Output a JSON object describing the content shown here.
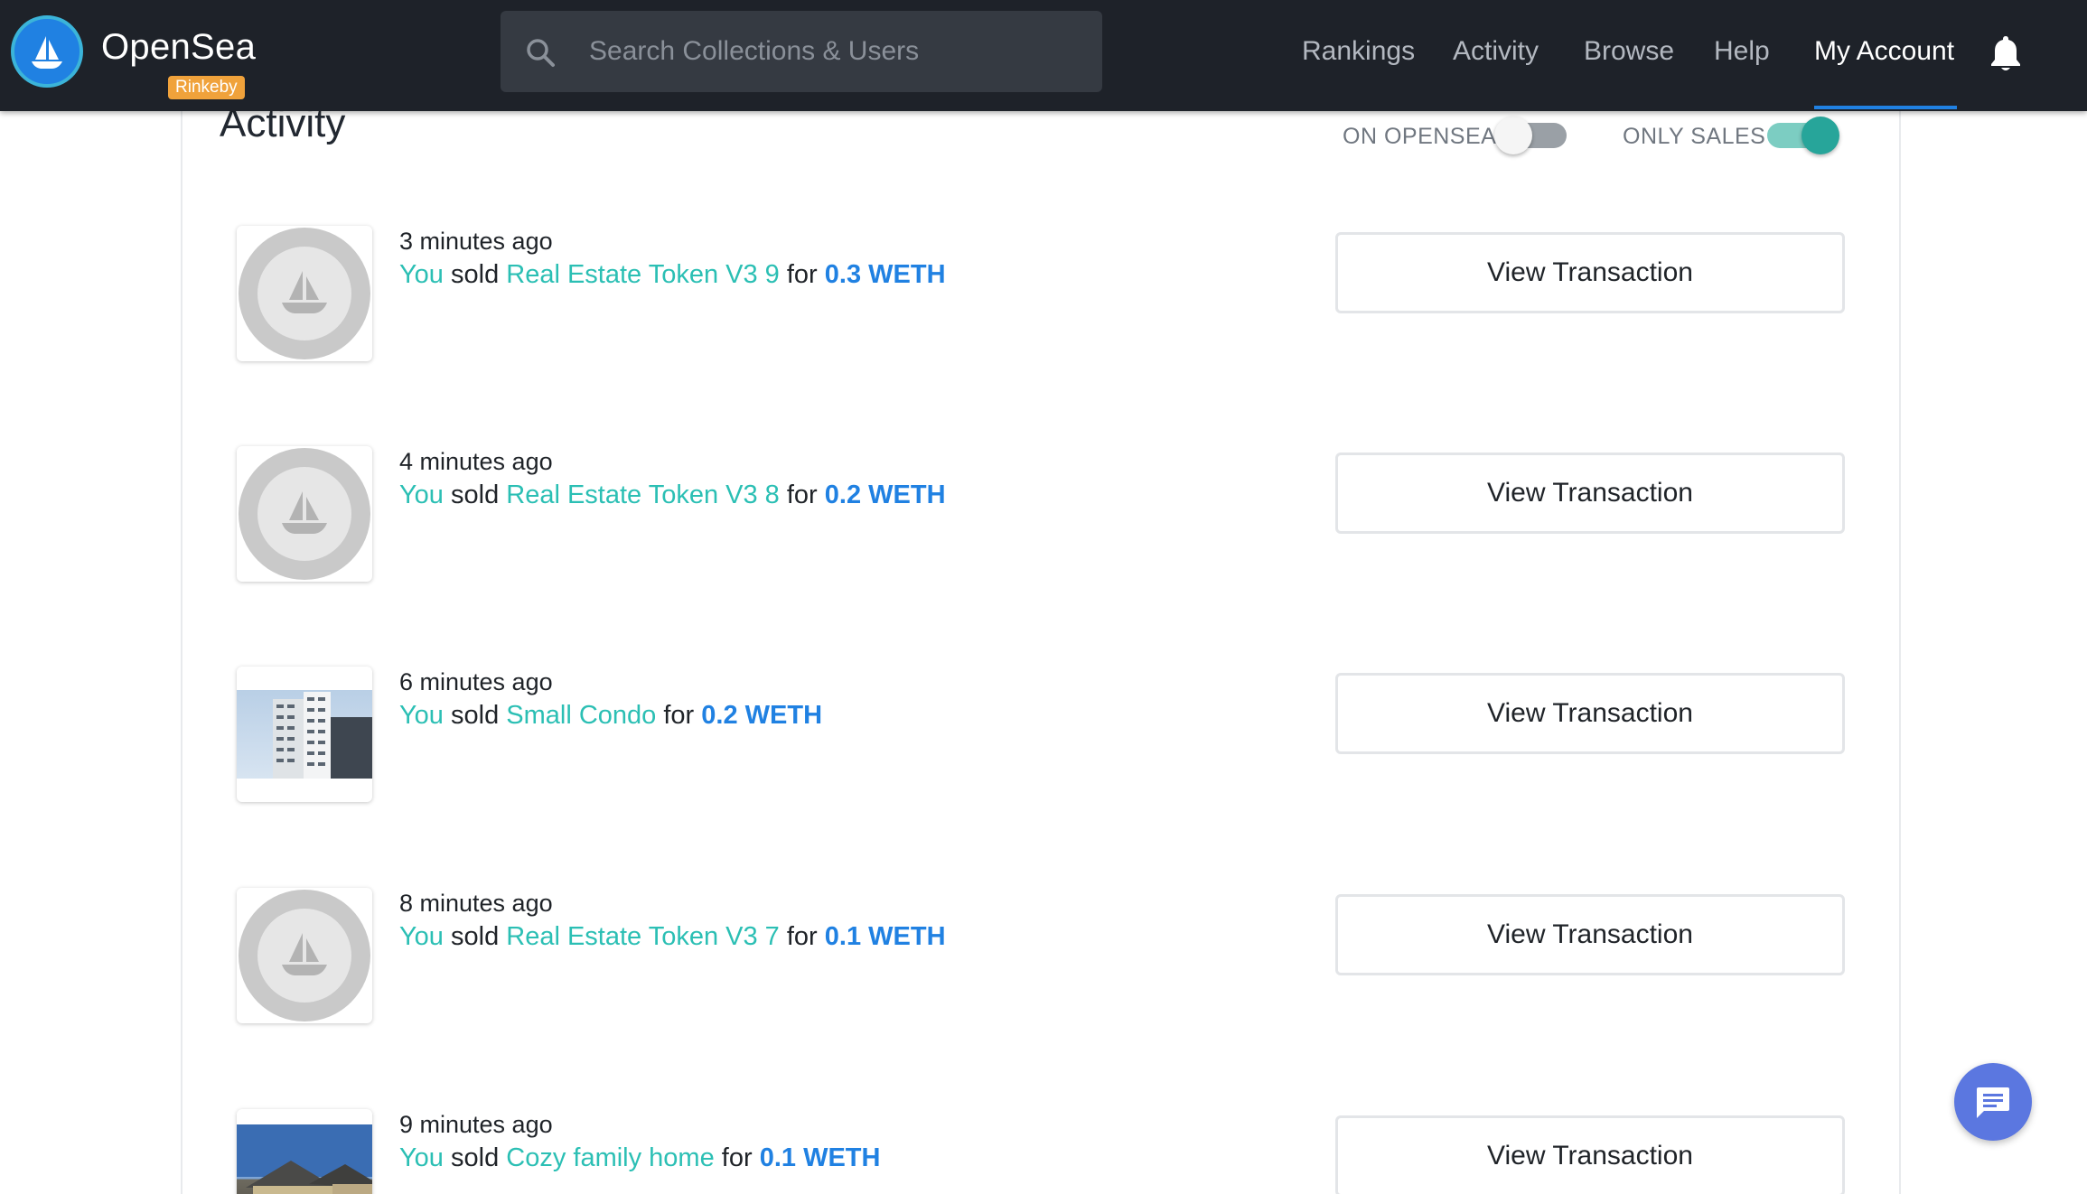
{
  "header": {
    "brand": "OpenSea",
    "network_badge": "Rinkeby",
    "search_placeholder": "Search Collections & Users",
    "nav": [
      {
        "label": "Rankings"
      },
      {
        "label": "Activity"
      },
      {
        "label": "Browse"
      },
      {
        "label": "Help"
      },
      {
        "label": "My Account",
        "active": true
      }
    ]
  },
  "page": {
    "title": "Activity",
    "filters": [
      {
        "label": "ON OPENSEA",
        "on": false
      },
      {
        "label": "ONLY SALES",
        "on": true
      }
    ]
  },
  "activity": [
    {
      "time": "3 minutes ago",
      "actor": "You",
      "verb": "sold",
      "item": "Real Estate Token V3 9",
      "for": "for",
      "price": "0.3 WETH",
      "button": "View Transaction",
      "thumb": "ship-placeholder-icon"
    },
    {
      "time": "4 minutes ago",
      "actor": "You",
      "verb": "sold",
      "item": "Real Estate Token V3 8",
      "for": "for",
      "price": "0.2 WETH",
      "button": "View Transaction",
      "thumb": "ship-placeholder-icon"
    },
    {
      "time": "6 minutes ago",
      "actor": "You",
      "verb": "sold",
      "item": "Small Condo",
      "for": "for",
      "price": "0.2 WETH",
      "button": "View Transaction",
      "thumb": "condo-photo"
    },
    {
      "time": "8 minutes ago",
      "actor": "You",
      "verb": "sold",
      "item": "Real Estate Token V3 7",
      "for": "for",
      "price": "0.1 WETH",
      "button": "View Transaction",
      "thumb": "ship-placeholder-icon"
    },
    {
      "time": "9 minutes ago",
      "actor": "You",
      "verb": "sold",
      "item": "Cozy family home",
      "for": "for",
      "price": "0.1 WETH",
      "button": "View Transaction",
      "thumb": "house-photo"
    }
  ],
  "colors": {
    "header_bg": "#1e2229",
    "accent_blue": "#2081e2",
    "link_teal": "#2bbfb4",
    "badge_orange": "#f0a23b",
    "toggle_on": "#27a59a",
    "chat_button": "#5b77e0"
  }
}
